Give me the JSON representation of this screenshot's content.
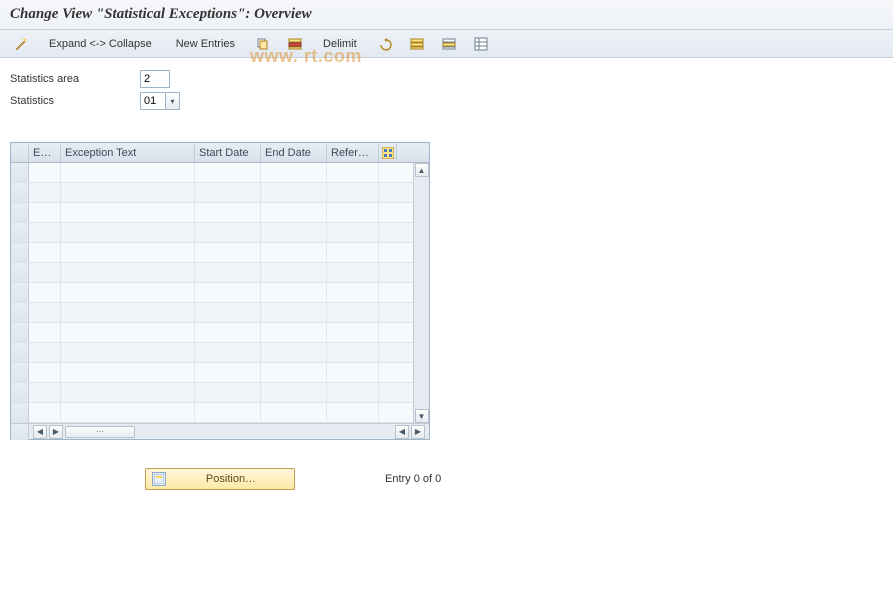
{
  "title": "Change View \"Statistical Exceptions\": Overview",
  "toolbar": {
    "expand_collapse": "Expand <-> Collapse",
    "new_entries": "New Entries",
    "delimit": "Delimit"
  },
  "icons": {
    "wand": "wand-icon",
    "copy": "copy-icon",
    "row_ops": "row-ops-icon",
    "undo": "undo-icon",
    "select_all": "select-all-icon",
    "deselect_all": "deselect-all-icon",
    "table_settings": "table-settings-icon",
    "config": "config-icon"
  },
  "form": {
    "stats_area_label": "Statistics area",
    "stats_area_value": "2",
    "stats_label": "Statistics",
    "stats_value": "01"
  },
  "grid": {
    "columns": {
      "ex": "Ex…",
      "text": "Exception Text",
      "start": "Start Date",
      "end": "End Date",
      "ref": "Refer…"
    },
    "row_count": 13
  },
  "footer": {
    "position_btn": "Position…",
    "entry_text": "Entry 0 of 0"
  },
  "watermark": "www.               rt.com"
}
